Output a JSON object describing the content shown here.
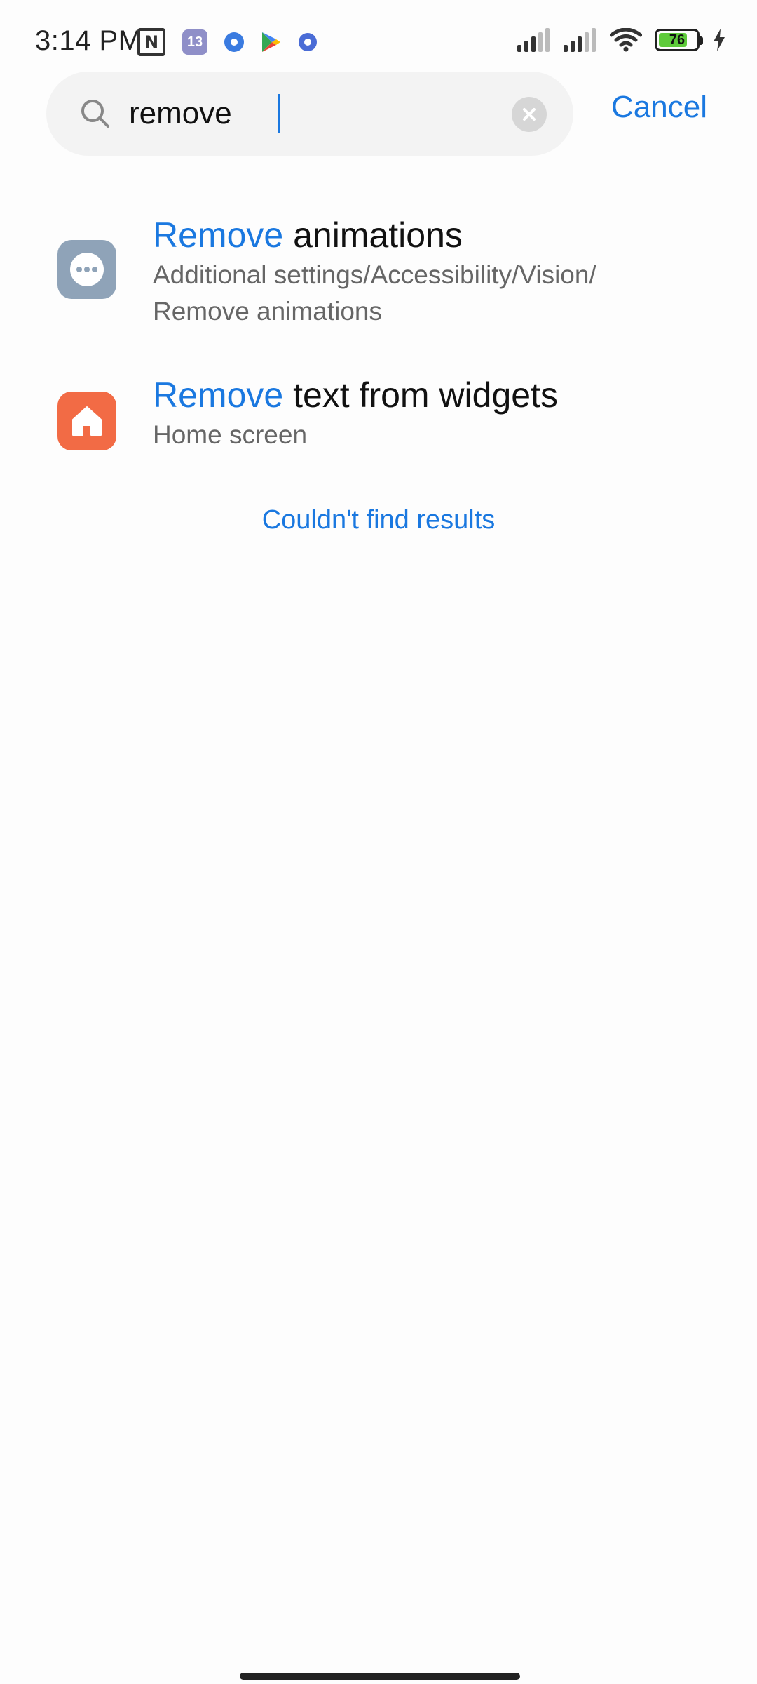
{
  "status_bar": {
    "time": "3:14 PM",
    "nfc_label": "N",
    "app_badge": "13",
    "battery": "76",
    "battery_level": 0.76,
    "icons": [
      "nfc-icon",
      "app-13-icon",
      "settings-gear-icon",
      "play-store-icon",
      "settings-gear-small-icon",
      "cell-signal-icon",
      "cell-signal-icon",
      "wifi-icon",
      "battery-icon",
      "charging-bolt-icon"
    ]
  },
  "search": {
    "value": "remove",
    "cancel_label": "Cancel"
  },
  "results": [
    {
      "icon": "more-dots-icon",
      "icon_color": "#8fa3b8",
      "title_highlight": "Remove",
      "title_rest": " animations",
      "path_line1": "Additional settings/Accessibility/Vision/",
      "path_line2": "Remove animations"
    },
    {
      "icon": "home-icon",
      "icon_color": "#f26b45",
      "title_highlight": "Remove",
      "title_rest": " text from widgets",
      "path_line1": "Home screen"
    }
  ],
  "not_found_label": "Couldn't find results",
  "colors": {
    "accent": "#1a78e0",
    "battery_fill": "#5ecb3a"
  }
}
